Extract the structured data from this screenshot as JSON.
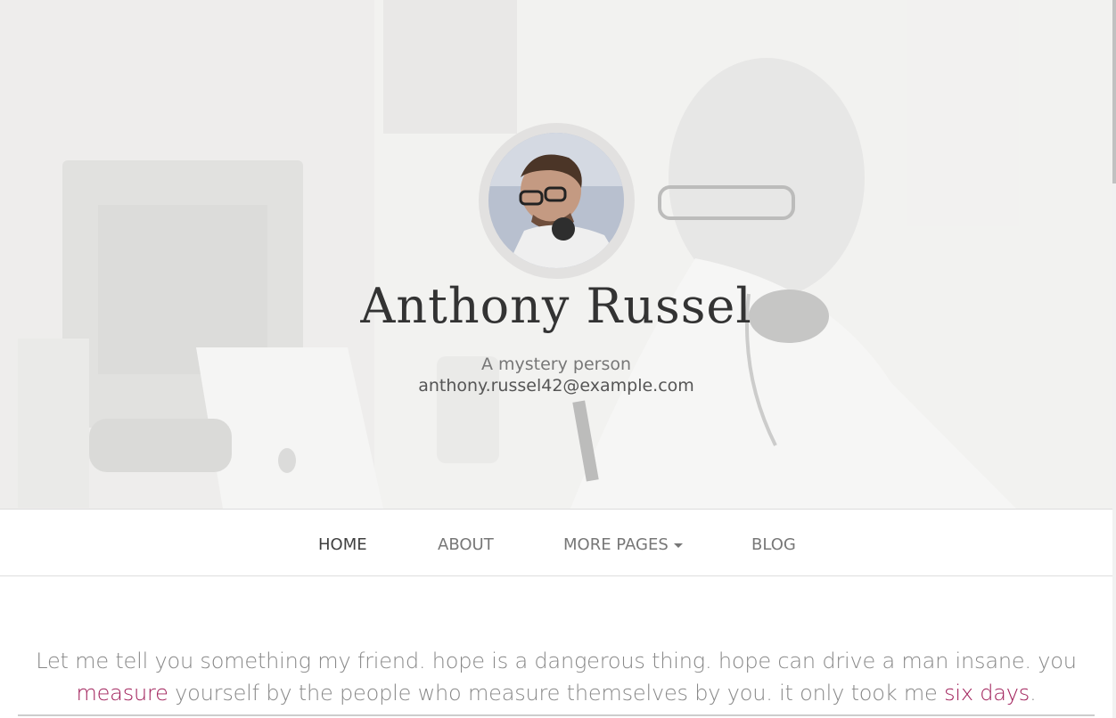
{
  "profile": {
    "name": "Anthony Russel",
    "tagline": "A mystery person",
    "email": "anthony.russel42@example.com"
  },
  "nav": {
    "items": [
      {
        "label": "HOME"
      },
      {
        "label": "ABOUT"
      },
      {
        "label": "MORE PAGES"
      },
      {
        "label": "BLOG"
      }
    ]
  },
  "intro": {
    "part1": "Let me tell you something my friend. hope is a dangerous thing. hope can drive a man insane. you",
    "link1": "measure",
    "part2": " yourself by the people who measure themselves by you. it only took me ",
    "link2": "six days",
    "part3": "."
  },
  "colors": {
    "accent": "#a1215b",
    "nav_text": "#777777",
    "hero_bg": "#ecebea"
  },
  "icons": {
    "dropdown": "caret-down-icon"
  }
}
